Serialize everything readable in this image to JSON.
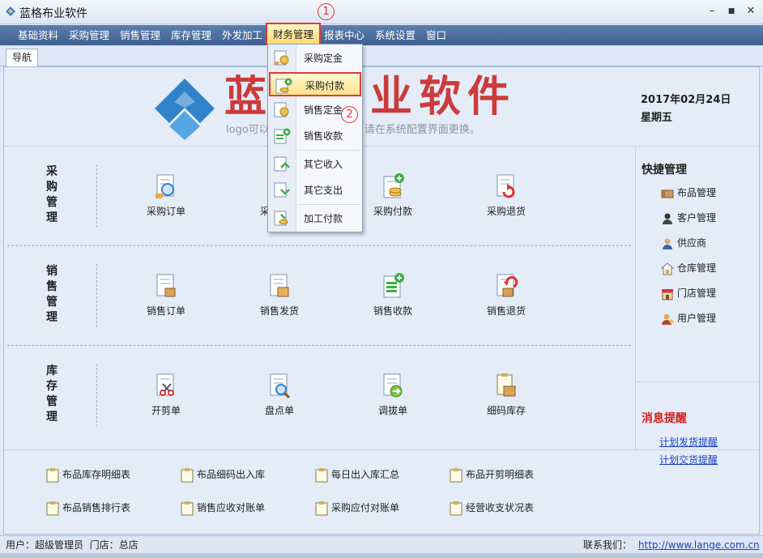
{
  "app": {
    "title": "蓝格布业软件"
  },
  "window_controls": {
    "minimize": "–",
    "maximize": "■",
    "close": "✕"
  },
  "menu": [
    {
      "label": "基础资料"
    },
    {
      "label": "采购管理"
    },
    {
      "label": "销售管理"
    },
    {
      "label": "库存管理"
    },
    {
      "label": "外发加工"
    },
    {
      "label": "财务管理"
    },
    {
      "label": "报表中心"
    },
    {
      "label": "系统设置"
    },
    {
      "label": "窗口"
    }
  ],
  "finance_menu": {
    "items": [
      {
        "label": "采购定金",
        "icon": "purchase-deposit-icon"
      },
      {
        "label": "采购付款",
        "icon": "purchase-payment-icon"
      },
      {
        "label": "销售定金",
        "icon": "sales-deposit-icon"
      },
      {
        "label": "销售收款",
        "icon": "sales-receipt-icon"
      },
      {
        "label": "其它收入",
        "icon": "other-income-icon"
      },
      {
        "label": "其它支出",
        "icon": "other-expense-icon"
      },
      {
        "label": "加工付款",
        "icon": "processing-payment-icon"
      }
    ]
  },
  "callouts": {
    "one": "1",
    "two": "2"
  },
  "tab": {
    "label": "导航"
  },
  "header": {
    "logo_text": "蓝格布业软件",
    "logo_sub": "logo可以根据客户要求定制，请在系统配置界面更换。",
    "date": "2017年02月24日",
    "weekday": "星期五"
  },
  "sections": {
    "purchase": {
      "title": "采购管理",
      "title_chars": [
        "采",
        "购",
        "管",
        "理"
      ],
      "items": [
        {
          "label": "采购订单",
          "icon": "purchase-order-icon"
        },
        {
          "label": "采购收货",
          "icon": "purchase-receive-icon"
        },
        {
          "label": "采购付款",
          "icon": "purchase-payment-icon"
        },
        {
          "label": "采购退货",
          "icon": "purchase-return-icon"
        }
      ]
    },
    "sales": {
      "title": "销售管理",
      "title_chars": [
        "销",
        "售",
        "管",
        "理"
      ],
      "items": [
        {
          "label": "销售订单",
          "icon": "sales-order-icon"
        },
        {
          "label": "销售发货",
          "icon": "sales-delivery-icon"
        },
        {
          "label": "销售收款",
          "icon": "sales-receipt-icon"
        },
        {
          "label": "销售退货",
          "icon": "sales-return-icon"
        }
      ]
    },
    "inventory": {
      "title": "库存管理",
      "title_chars": [
        "库",
        "存",
        "管",
        "理"
      ],
      "items": [
        {
          "label": "开剪单",
          "icon": "cutting-order-icon"
        },
        {
          "label": "盘点单",
          "icon": "stocktake-icon"
        },
        {
          "label": "调拔单",
          "icon": "transfer-order-icon"
        },
        {
          "label": "细码库存",
          "icon": "detail-stock-icon"
        }
      ]
    }
  },
  "sidebar": {
    "quick_title": "快捷管理",
    "quick_items": [
      {
        "label": "布品管理",
        "icon": "fabric-icon"
      },
      {
        "label": "客户管理",
        "icon": "customer-icon"
      },
      {
        "label": "供应商",
        "icon": "supplier-icon"
      },
      {
        "label": "仓库管理",
        "icon": "warehouse-icon"
      },
      {
        "label": "门店管理",
        "icon": "store-icon"
      },
      {
        "label": "用户管理",
        "icon": "user-icon"
      }
    ],
    "msg_title": "消息提醒",
    "msg_links": [
      {
        "label": "计划发货提醒"
      },
      {
        "label": "计划交货提醒"
      }
    ]
  },
  "reports": [
    {
      "label": "布品库存明细表"
    },
    {
      "label": "布品细码出入库"
    },
    {
      "label": "每日出入库汇总"
    },
    {
      "label": "布品开剪明细表"
    },
    {
      "label": "布品销售排行表"
    },
    {
      "label": "销售应收对账单"
    },
    {
      "label": "采购应付对账单"
    },
    {
      "label": "经营收支状况表"
    }
  ],
  "status": {
    "user_label": "用户：",
    "user": "超级管理员",
    "store_label": "门店：",
    "store": "总店",
    "contact_label": "联系我们：",
    "url": "http://www.lange.com.cn"
  },
  "colors": {
    "menubar": "#4a6b9c",
    "highlight": "#fde38a",
    "callout_red": "#e23b3b",
    "logo_red": "#cc3b3b",
    "logo_blue": "#2f83c9",
    "alert_title": "#d01e1e",
    "link": "#1a3fbf"
  }
}
